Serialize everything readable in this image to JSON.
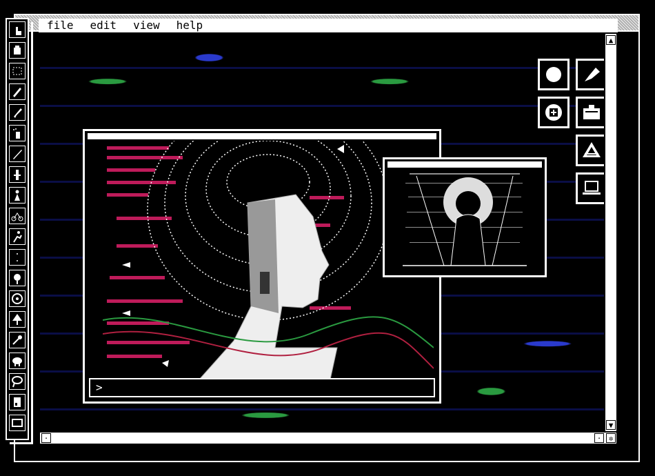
{
  "menu": {
    "file": "file",
    "edit": "edit",
    "view": "view",
    "help": "help"
  },
  "main_window": {
    "prompt": ">"
  },
  "tools": [
    "pointer-hand-icon",
    "bucket-icon",
    "marquee-icon",
    "pencil-icon",
    "brush-icon",
    "spray-icon",
    "pen-icon",
    "tower-icon",
    "person-icon",
    "bicycle-icon",
    "runner-icon",
    "dots-icon",
    "plant-icon",
    "gear-icon",
    "tree-icon",
    "key-icon",
    "sheep-icon",
    "lasso-icon",
    "page-icon",
    "screen-icon"
  ],
  "palette": [
    "circle-icon",
    "pen-nib-icon",
    "plus-circle-icon",
    "briefcase-icon",
    "triangle-icon",
    "laptop-icon"
  ],
  "colors": {
    "accent_pink": "#e0206a",
    "accent_green": "#2a9a40",
    "accent_blue": "#2a3acc"
  }
}
